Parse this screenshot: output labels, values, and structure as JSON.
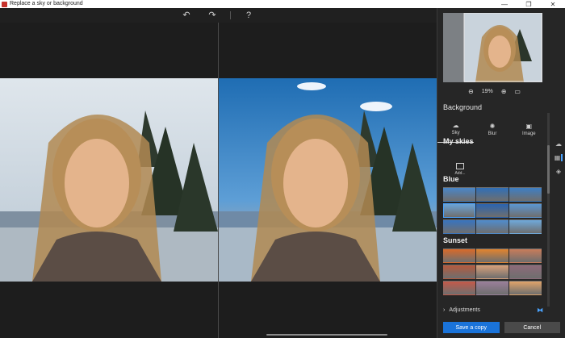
{
  "window": {
    "title": "Replace a sky or background",
    "minimize": "—",
    "restore": "❐",
    "close": "✕"
  },
  "toolbar": {
    "undo_glyph": "↶",
    "redo_glyph": "↷",
    "help_glyph": "?"
  },
  "panel": {
    "zoom": {
      "out_glyph": "⊖",
      "level": "19%",
      "in_glyph": "⊕",
      "fit_glyph": "▭"
    },
    "section_title": "Background",
    "tabs": [
      {
        "label": "Sky",
        "icon": "☁",
        "active": true
      },
      {
        "label": "Blur",
        "icon": "✺",
        "active": false
      },
      {
        "label": "Image",
        "icon": "▣",
        "active": false
      }
    ],
    "my_skies": {
      "title": "My skies",
      "add_label": "Add..."
    },
    "blue": {
      "title": "Blue"
    },
    "sunset": {
      "title": "Sunset"
    },
    "adjustments_label": "Adjustments",
    "save_label": "Save a copy",
    "cancel_label": "Cancel"
  },
  "colors": {
    "accent": "#1a73d9",
    "selection": "#4aa3ff",
    "panel_bg": "#262626",
    "canvas_bg": "#1d1d1d"
  },
  "blue_skies": [
    "#4a86c8",
    "#2f6fb8",
    "#3e7fc4",
    "#6aa4d8",
    "#2a64b0",
    "#5b96d2",
    "#3874c0",
    "#4f8ccd",
    "#6fa9db"
  ],
  "sunset_skies": [
    "#d86a2a",
    "#e2842e",
    "#c87c5a",
    "#b45a3e",
    "#d7a07a",
    "#8e6a7a",
    "#c45a4a",
    "#9a7f9a",
    "#e0a46a"
  ]
}
